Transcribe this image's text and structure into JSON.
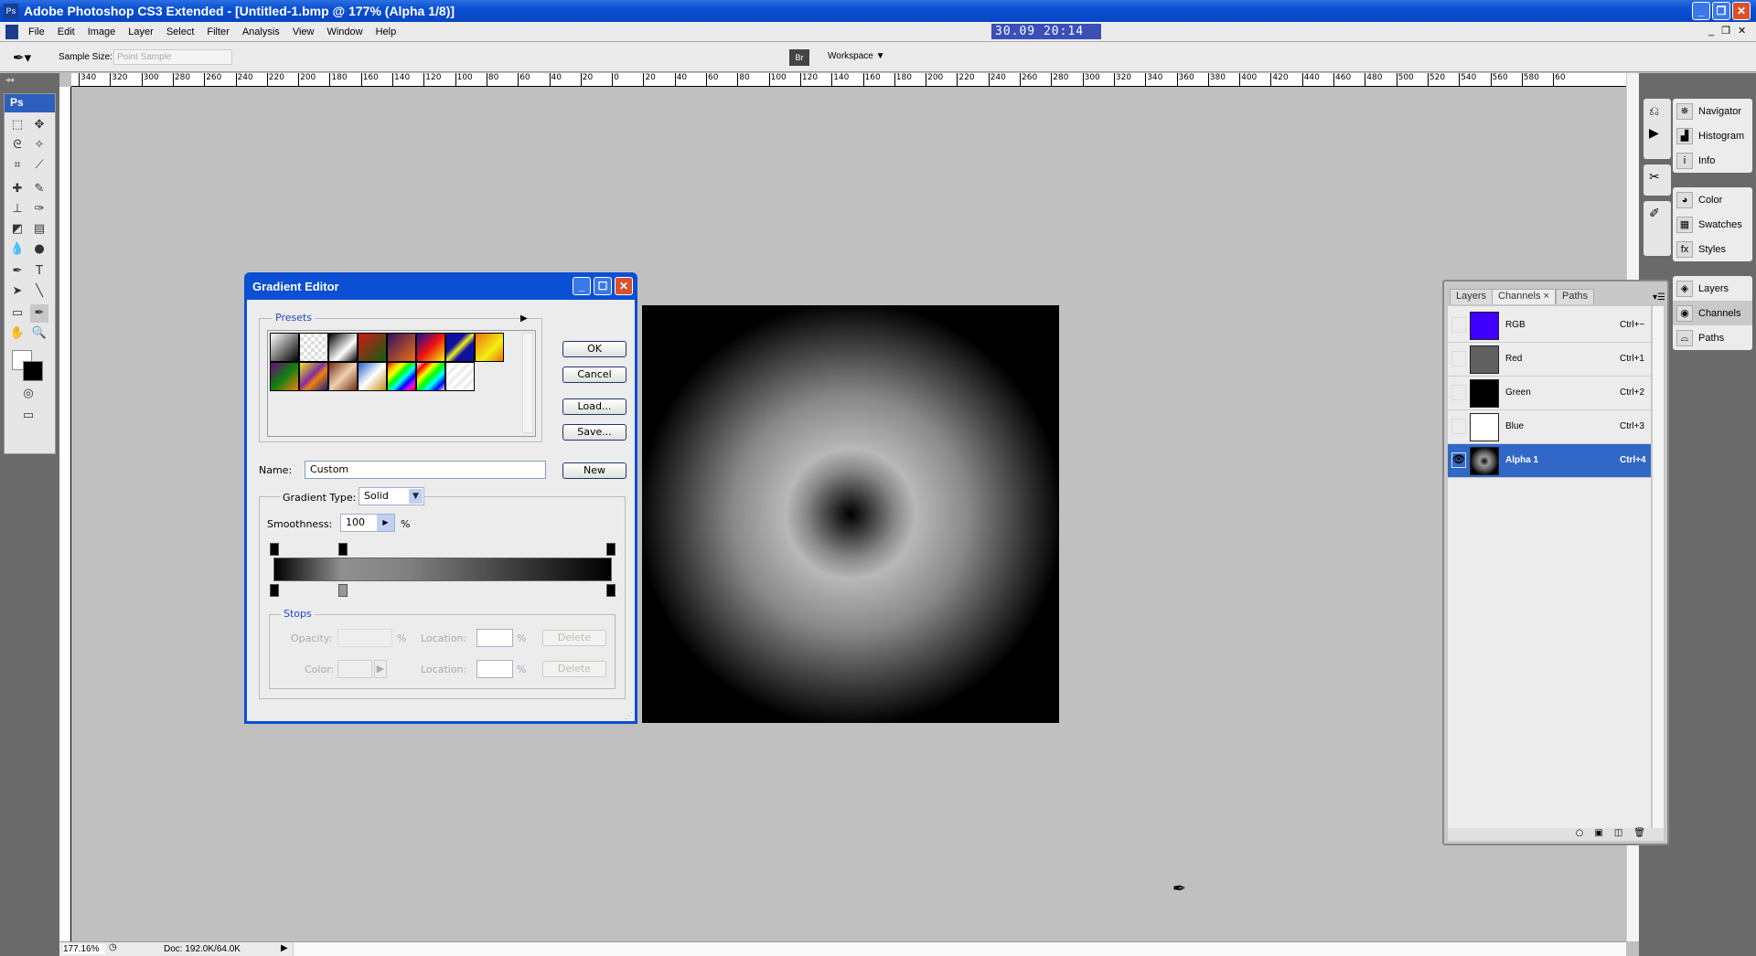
{
  "window": {
    "title": "Adobe Photoshop CS3 Extended - [Untitled-1.bmp @ 177% (Alpha 1/8)]",
    "clock": "30.09  20:14"
  },
  "menu": [
    "File",
    "Edit",
    "Image",
    "Layer",
    "Select",
    "Filter",
    "Analysis",
    "View",
    "Window",
    "Help"
  ],
  "options": {
    "sample_size_label": "Sample Size:",
    "sample_size_value": "Point Sample",
    "workspace": "Workspace ▼"
  },
  "ruler": {
    "h_labels": [
      "340",
      "320",
      "300",
      "280",
      "260",
      "240",
      "220",
      "200",
      "180",
      "160",
      "140",
      "120",
      "100",
      "80",
      "60",
      "40",
      "20",
      "0",
      "20",
      "40",
      "60",
      "80",
      "100",
      "120",
      "140",
      "160",
      "180",
      "200",
      "220",
      "240",
      "260",
      "280",
      "300",
      "320",
      "340",
      "360",
      "380",
      "400",
      "420",
      "440",
      "460",
      "480",
      "500",
      "520",
      "540",
      "560",
      "580",
      "60"
    ]
  },
  "status": {
    "zoom": "177.16%",
    "doc": "Doc: 192.0K/64.0K"
  },
  "dialog": {
    "title": "Gradient Editor",
    "presets_label": "Presets",
    "presets": [
      "linear-gradient(135deg,#fff,#000)",
      "repeating-conic-gradient(#ddd 0 25%,#fff 0 50%) 0 0/8px 8px",
      "linear-gradient(135deg,#000,#fff 60%,#000)",
      "linear-gradient(135deg,#d01818,#106010)",
      "linear-gradient(135deg,#301060,#f07010)",
      "linear-gradient(135deg,#1010a0,#f01010 50%,#f0f010)",
      "linear-gradient(135deg,#1010a0 35%,#f0f020 50%,#1010a0 65%)",
      "linear-gradient(135deg,#f07010,#f0f010 60%,#f07010)",
      "linear-gradient(135deg,#700080,#108010 50%,#f08010)",
      "linear-gradient(135deg,#f0f010,#8030a0 45%,#f08010 60%,#102080)",
      "linear-gradient(135deg,#703010,#f0d0b0 50%,#703010)",
      "linear-gradient(135deg,#2060c0,#fff 50%,#c09010)",
      "linear-gradient(135deg,red,orange,yellow,lime,cyan,blue,magenta,red)",
      "linear-gradient(135deg,#eee,red,yellow,lime,cyan,blue,#eee)",
      "repeating-linear-gradient(135deg,#eee 0 4px,#fff 4px 8px)"
    ],
    "buttons": {
      "ok": "OK",
      "cancel": "Cancel",
      "load": "Load...",
      "save": "Save...",
      "new": "New"
    },
    "name_label": "Name:",
    "name_value": "Custom",
    "gradient_type_label": "Gradient Type:",
    "gradient_type_value": "Solid",
    "smoothness_label": "Smoothness:",
    "smoothness_value": "100",
    "percent": "%",
    "stops_label": "Stops",
    "opacity_label": "Opacity:",
    "color_label": "Color:",
    "location_label": "Location:",
    "delete": "Delete"
  },
  "panels": {
    "group1": [
      {
        "icon": "navigator-icon",
        "label": "Navigator"
      },
      {
        "icon": "histogram-icon",
        "label": "Histogram"
      },
      {
        "icon": "info-icon",
        "label": "Info"
      }
    ],
    "group2": [
      {
        "icon": "color-icon",
        "label": "Color"
      },
      {
        "icon": "swatches-icon",
        "label": "Swatches"
      },
      {
        "icon": "styles-icon",
        "label": "Styles"
      }
    ],
    "group3": [
      {
        "icon": "layers-icon",
        "label": "Layers"
      },
      {
        "icon": "channels-icon",
        "label": "Channels"
      },
      {
        "icon": "paths-icon",
        "label": "Paths"
      }
    ]
  },
  "channels_panel": {
    "tabs": [
      "Layers",
      "Channels",
      "Paths"
    ],
    "active_tab": "Channels",
    "rows": [
      {
        "name": "RGB",
        "shortcut": "Ctrl+~",
        "thumb": "#4000ff",
        "visible": false
      },
      {
        "name": "Red",
        "shortcut": "Ctrl+1",
        "thumb": "#606060",
        "visible": false
      },
      {
        "name": "Green",
        "shortcut": "Ctrl+2",
        "thumb": "#000000",
        "visible": false
      },
      {
        "name": "Blue",
        "shortcut": "Ctrl+3",
        "thumb": "#ffffff",
        "visible": false
      },
      {
        "name": "Alpha 1",
        "shortcut": "Ctrl+4",
        "thumb": "radial",
        "visible": true,
        "selected": true
      }
    ]
  }
}
